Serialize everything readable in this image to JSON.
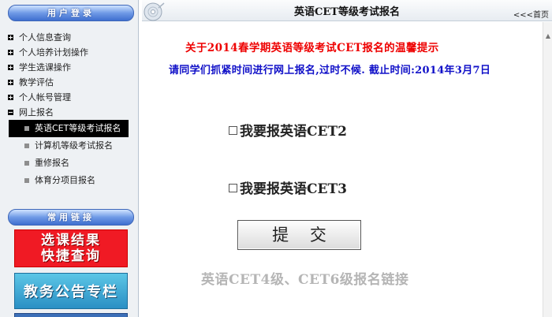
{
  "sidebar": {
    "login_header": "用户登录",
    "links_header": "常用链接",
    "menu": [
      {
        "label": "个人信息查询",
        "icon": "plus"
      },
      {
        "label": "个人培养计划操作",
        "icon": "plus"
      },
      {
        "label": "学生选课操作",
        "icon": "plus"
      },
      {
        "label": "教学评估",
        "icon": "plus"
      },
      {
        "label": "个人帐号管理",
        "icon": "plus"
      },
      {
        "label": "网上报名",
        "icon": "minus"
      }
    ],
    "submenu": [
      {
        "label": "英语CET等级考试报名",
        "active": true
      },
      {
        "label": "计算机等级考试报名",
        "active": false
      },
      {
        "label": "重修报名",
        "active": false
      },
      {
        "label": "体育分项目报名",
        "active": false
      }
    ],
    "banners": {
      "red_line1": "选课结果",
      "red_line2": "快捷查询",
      "blue": "教务公告专栏"
    }
  },
  "header": {
    "title": "英语CET等级考试报名",
    "home_link": "<<<首页"
  },
  "main": {
    "notice_title": "关于2014春学期英语等级考试CET报名的温馨提示",
    "notice_body": "请同学们抓紧时间进行网上报名,过时不候. 截止时间:2014年3月7日",
    "option_cet2": "我要报英语CET2",
    "option_cet3": "我要报英语CET3",
    "submit_label": "提 交",
    "cet46_link": "英语CET4级、CET6级报名链接"
  },
  "colors": {
    "notice_title": "#ee0000",
    "notice_body": "#1010c8",
    "active_menu_bg": "#000000",
    "link_gray": "#b5b5b5"
  }
}
